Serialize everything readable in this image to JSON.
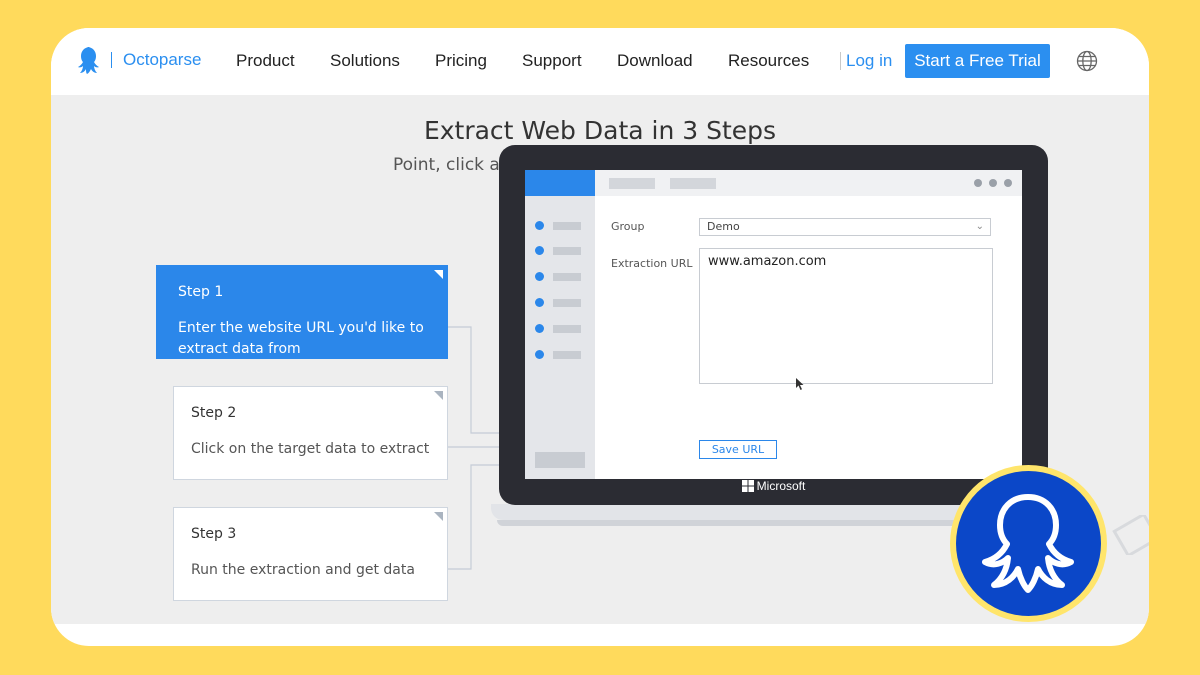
{
  "brand": {
    "name": "Octoparse"
  },
  "nav": {
    "links": [
      "Product",
      "Solutions",
      "Pricing",
      "Support",
      "Download",
      "Resources"
    ],
    "login": "Log in",
    "cta": "Start a Free Trial"
  },
  "hero": {
    "title": "Extract Web Data in 3 Steps",
    "subtitle": "Point, click and extract. No coding needed at all!"
  },
  "steps": [
    {
      "title": "Step 1",
      "text": "Enter the website URL you'd like to extract data from",
      "active": true
    },
    {
      "title": "Step 2",
      "text": "Click on the target data to extract",
      "active": false
    },
    {
      "title": "Step 3",
      "text": "Run the extraction and get data",
      "active": false
    }
  ],
  "app": {
    "group_label": "Group",
    "group_value": "Demo",
    "url_label": "Extraction URL",
    "url_value": "www.amazon.com",
    "save_label": "Save URL"
  },
  "laptop": {
    "brand": "Microsoft"
  },
  "colors": {
    "accent": "#2b87ea",
    "background": "#FFDA5C",
    "badge": "#0B47C8"
  },
  "icons": [
    "octopus-logo-icon",
    "globe-icon",
    "microsoft-logo-icon",
    "cursor-icon",
    "chevron-down-icon"
  ]
}
